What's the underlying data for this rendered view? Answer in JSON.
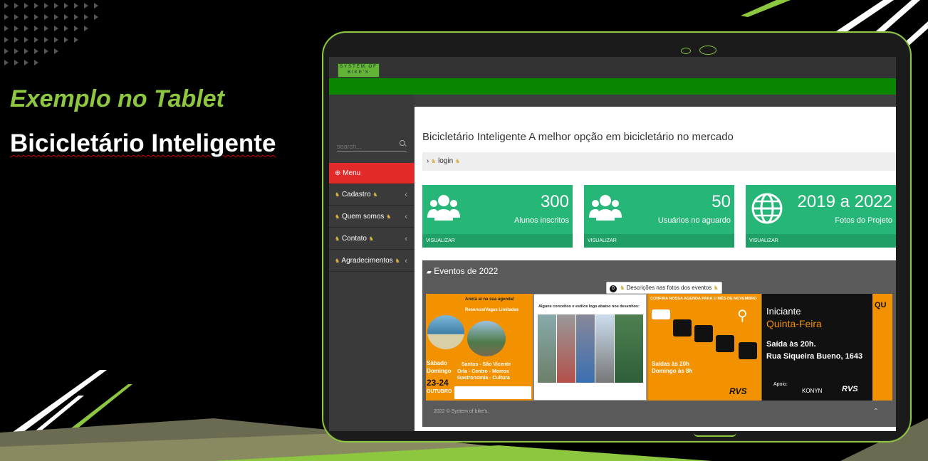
{
  "slide": {
    "title": "Exemplo no Tablet",
    "subtitle": "Bicicletário Inteligente"
  },
  "app": {
    "logo_text": "SYSTEM OF BIKE'S",
    "search_placeholder": "search...",
    "menu": [
      {
        "label": "Menu"
      },
      {
        "label": "Cadastro"
      },
      {
        "label": "Quem somos"
      },
      {
        "label": "Contato"
      },
      {
        "label": "Agradecimentos"
      }
    ],
    "page_heading": "Bicicletário Inteligente A melhor opção em bicicletário no mercado",
    "breadcrumb": "login",
    "cards": [
      {
        "value": "300",
        "label": "Alunos inscritos",
        "footer": "VISUALIZAR",
        "icon": "users-icon"
      },
      {
        "value": "50",
        "label": "Usuários no aguardo",
        "footer": "VISUALIZAR",
        "icon": "users-icon"
      },
      {
        "value": "2019 a 2022",
        "label": "Fotos do Projeto",
        "footer": "VISUALIZAR",
        "icon": "globe-icon"
      }
    ],
    "events": {
      "title": "Eventos de 2022",
      "desc_count": "0",
      "desc_button": "Descrições nas fotos dos eventos",
      "footer": "2022 © System of bike's."
    },
    "posters": {
      "p1": {
        "l1": "Anota aí na sua agenda!",
        "l2": "Reservas/Vagas Limitadas",
        "l3": "Sábado",
        "l4": "Domingo",
        "l5": "23-24",
        "l6": "OUTUBRO",
        "l7": "Santos - São Vicente",
        "l8": "Orla - Centro - Morros",
        "l9": "Gastronomia - Cultura"
      },
      "p2": {
        "l1": "Alguns conceitos e estilos logo abaixo nos desenhos:"
      },
      "p3": {
        "l1": "CONFIRA NOSSA AGENDA PARA O MÊS DE NOVEMBRO",
        "l2": "Saídas às 20h",
        "l3": "Domingo às 8h",
        "l4": "RVS"
      },
      "p4": {
        "l1": "Iniciante",
        "l2": "Quinta-Feira",
        "l3": "Saída às 20h.",
        "l4": "Rua Siqueira Bueno, 1643",
        "l5": "Apoio:",
        "l6": "KONYN",
        "l7": "RVS",
        "l8": "QU"
      }
    }
  },
  "colors": {
    "accent_green": "#8dc63f",
    "nav_green": "#0a8500",
    "card_green": "#26b678",
    "menu_red": "#e22a2a",
    "poster_orange": "#f39200"
  }
}
